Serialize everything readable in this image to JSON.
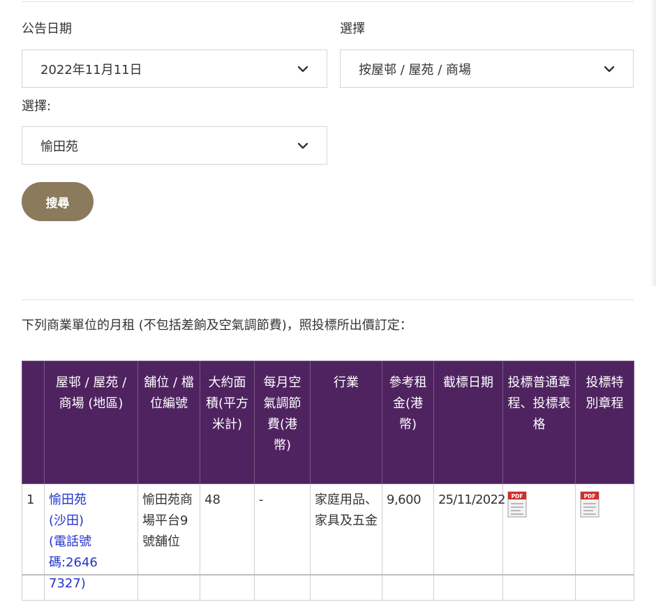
{
  "filters": {
    "date_label": "公告日期",
    "date_value": "2022年11月11日",
    "select_label": "選擇",
    "select_value": "按屋邨 / 屋苑 / 商場",
    "estate_label": "選擇:",
    "estate_value": "愉田苑",
    "search_button": "搜尋"
  },
  "intro_text": "下列商業單位的月租 (不包括差餉及空氣調節費)，照投標所出價訂定：",
  "table": {
    "headers": [
      "",
      "屋邨 / 屋苑 / 商場 (地區)",
      "舖位 / 檔位編號",
      "大約面積(平方米計)",
      "每月空氣調節費(港幣)",
      "行業",
      "參考租金(港幣)",
      "截標日期",
      "投標普通章程、投標表格",
      "投標特別章程"
    ],
    "rows": [
      {
        "no": "1",
        "estate": "愉田苑",
        "district": "(沙田)",
        "phone": "(電話號碼:2646 7327)",
        "unit": "愉田苑商場平台9號舖位",
        "area": "48",
        "ac_fee": "-",
        "trade": "家庭用品、家具及五金",
        "rent": "9,600",
        "closing_date": "25/11/2022",
        "general_doc_icon": "pdf-icon",
        "special_doc_icon": "pdf-icon"
      }
    ]
  },
  "colors": {
    "header_bg": "#4f2360",
    "button_bg": "#8b7a5c",
    "link": "#2233cc"
  }
}
